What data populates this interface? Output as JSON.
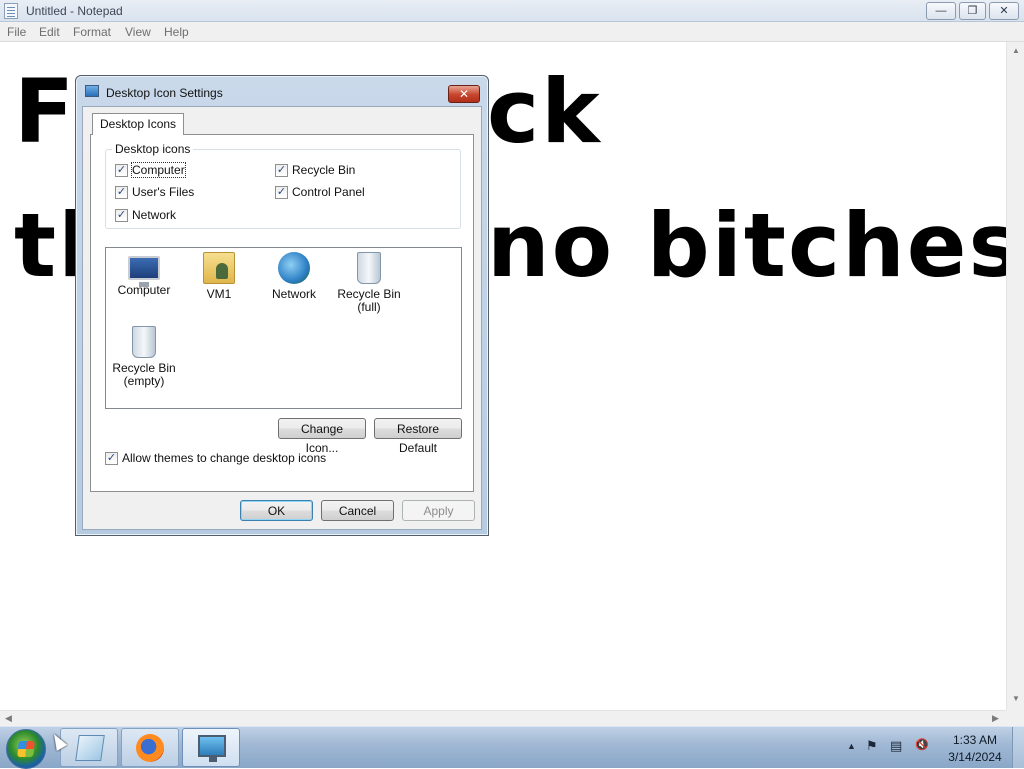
{
  "notepad": {
    "title": "Untitled - Notepad",
    "menu": [
      "File",
      "Edit",
      "Format",
      "View",
      "Help"
    ],
    "text_lines": [
      "Fuck",
      "the",
      "no bitches"
    ],
    "visible_text": {
      "line1_left": "F",
      "line1_right": "ck",
      "line2_left": "th",
      "line2_right": "no bitches"
    },
    "scroll_arrows": {
      "up": "▲",
      "down": "▼",
      "left": "◀",
      "right": "▶"
    },
    "caption_buttons": {
      "minimize": "—",
      "maximize": "❐",
      "close": "✕"
    }
  },
  "dialog": {
    "title": "Desktop Icon Settings",
    "close_glyph": "✕",
    "tab": "Desktop Icons",
    "group_legend": "Desktop icons",
    "checkboxes": [
      {
        "label": "Computer",
        "checked": true
      },
      {
        "label": "Recycle Bin",
        "checked": true
      },
      {
        "label": "User's Files",
        "checked": true
      },
      {
        "label": "Control Panel",
        "checked": true
      },
      {
        "label": "Network",
        "checked": true
      }
    ],
    "icons": [
      {
        "label": "Computer",
        "icon": "computer-icon"
      },
      {
        "label": "VM1",
        "icon": "user-folder-icon"
      },
      {
        "label": "Network",
        "icon": "network-icon"
      },
      {
        "label": "Recycle Bin (full)",
        "line1": "Recycle Bin",
        "line2": "(full)",
        "icon": "recycle-bin-full-icon"
      },
      {
        "label": "Recycle Bin (empty)",
        "line1": "Recycle Bin",
        "line2": "(empty)",
        "icon": "recycle-bin-empty-icon"
      }
    ],
    "change_icon_button": "Change Icon...",
    "restore_default_button": "Restore Default",
    "allow_themes": {
      "label": "Allow themes to change desktop icons",
      "checked": true
    },
    "ok_button": "OK",
    "cancel_button": "Cancel",
    "apply_button": "Apply",
    "check_glyph": "✓"
  },
  "taskbar": {
    "pinned": [
      {
        "name": "Notepad",
        "icon": "notepad-icon"
      },
      {
        "name": "Firefox",
        "icon": "firefox-icon"
      },
      {
        "name": "Desktop Icon Settings",
        "icon": "display-settings-icon",
        "active": true
      }
    ],
    "tray": {
      "show_hidden": "▲",
      "flag": "⚑",
      "network": "▤",
      "volume": "🔇"
    },
    "clock": {
      "time": "1:33 AM",
      "date": "3/14/2024"
    }
  }
}
